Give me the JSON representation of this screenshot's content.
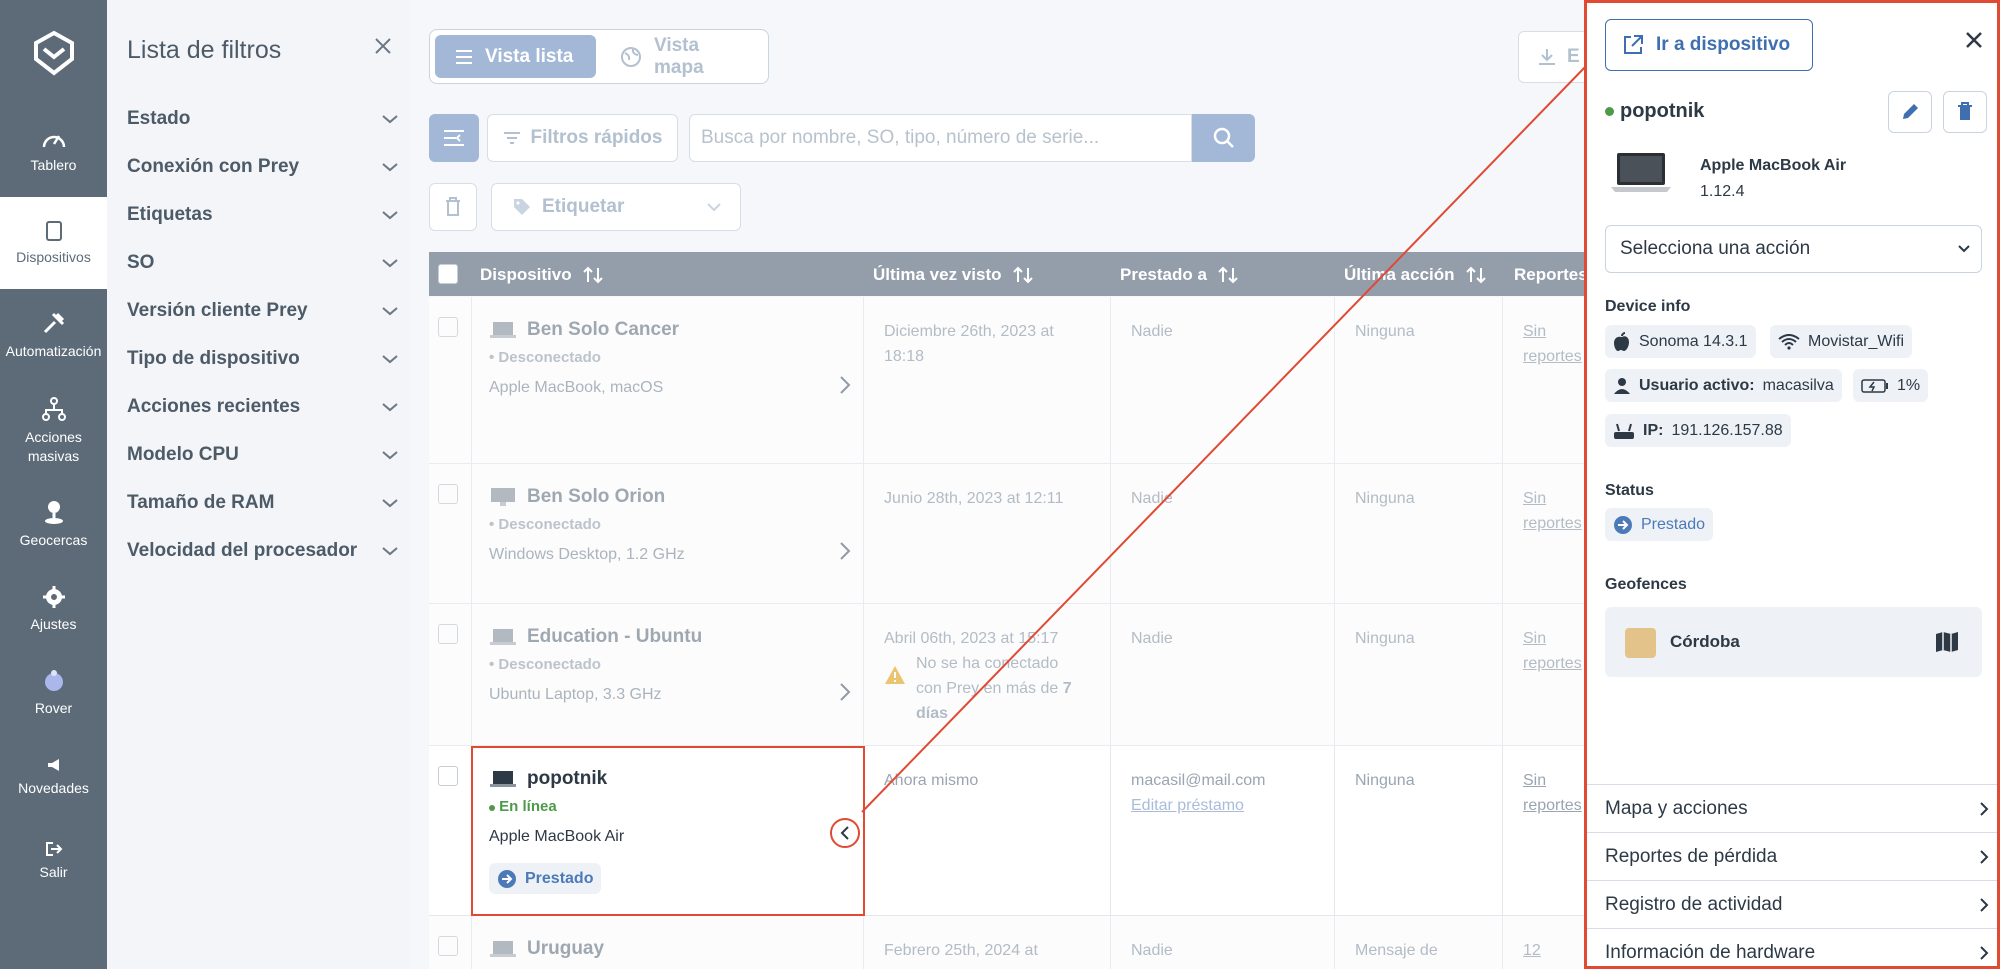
{
  "nav": {
    "items": [
      {
        "label": "Tablero",
        "icon": "gauge-icon"
      },
      {
        "label": "Dispositivos",
        "icon": "tablet-icon"
      },
      {
        "label": "Automatización",
        "icon": "tools-icon"
      },
      {
        "label": "Acciones masivas",
        "icon": "network-icon"
      },
      {
        "label": "Geocercas",
        "icon": "pin-icon"
      },
      {
        "label": "Ajustes",
        "icon": "gear-icon"
      },
      {
        "label": "Rover",
        "icon": "rover-icon"
      },
      {
        "label": "Novedades",
        "icon": "megaphone-icon"
      },
      {
        "label": "Salir",
        "icon": "logout-icon"
      }
    ]
  },
  "filters": {
    "title": "Lista de filtros",
    "items": [
      "Estado",
      "Conexión con Prey",
      "Etiquetas",
      "SO",
      "Versión cliente Prey",
      "Tipo de dispositivo",
      "Acciones recientes",
      "Modelo CPU",
      "Tamaño de RAM",
      "Velocidad del procesador"
    ]
  },
  "toolbar": {
    "list_view": "Vista lista",
    "map_view": "Vista mapa",
    "export_label": "E",
    "quick_filters": "Filtros rápidos",
    "search_placeholder": "Busca por nombre, SO, tipo, número de serie...",
    "tag_label": "Etiquetar"
  },
  "table": {
    "columns": [
      "Dispositivo",
      "Última vez visto",
      "Prestado a",
      "Última acción",
      "Reportes"
    ],
    "rows": [
      {
        "name": "Ben Solo Cancer",
        "status": "Desconectado",
        "model": "Apple MacBook, macOS",
        "last_seen": "Diciembre 26th, 2023 at 18:18",
        "loaned_to": "Nadie",
        "last_action": "Ninguna",
        "reports": "Sin reportes"
      },
      {
        "name": "Ben Solo Orion",
        "status": "Desconectado",
        "model": "Windows Desktop, 1.2 GHz",
        "last_seen": "Junio 28th, 2023 at 12:11",
        "loaned_to": "Nadie",
        "last_action": "Ninguna",
        "reports": "Sin reportes"
      },
      {
        "name": "Education - Ubuntu",
        "status": "Desconectado",
        "model": "Ubuntu Laptop, 3.3 GHz",
        "last_seen": "Abril 06th, 2023 at 15:17",
        "warning_pre": "No se ha conectado con Prey en más de ",
        "warning_bold": "7 días",
        "loaned_to": "Nadie",
        "last_action": "Ninguna",
        "reports": "Sin reportes"
      },
      {
        "name": "popotnik",
        "status": "En línea",
        "model": "Apple MacBook Air",
        "badge": "Prestado",
        "last_seen": "Ahora mismo",
        "loaned_to": "macasil@mail.com",
        "edit_loan": "Editar préstamo",
        "last_action": "Ninguna",
        "reports": "Sin reportes"
      },
      {
        "name": "Uruguay",
        "last_seen": "Febrero 25th, 2024 at",
        "loaned_to": "Nadie",
        "last_action": "Mensaje de",
        "reports": "12"
      }
    ]
  },
  "panel": {
    "goto_label": "Ir a dispositivo",
    "device_name": "popotnik",
    "model": "Apple MacBook Air",
    "version": "1.12.4",
    "action_select": "Selecciona una acción",
    "device_info_title": "Device info",
    "os": "Sonoma 14.3.1",
    "wifi": "Movistar_Wifi",
    "user_label": "Usuario activo:",
    "user_value": "macasilva",
    "battery": "1%",
    "ip_label": "IP:",
    "ip_value": "191.126.157.88",
    "status_title": "Status",
    "status_value": "Prestado",
    "geofences_title": "Geofences",
    "geofence_name": "Córdoba",
    "accordion": [
      "Mapa y acciones",
      "Reportes de pérdida",
      "Registro de actividad",
      "Información de hardware"
    ]
  },
  "colors": {
    "accent": "#3f6fb1",
    "highlight": "#e04a33",
    "rail": "#5d6b79",
    "online": "#4f9a4a"
  }
}
